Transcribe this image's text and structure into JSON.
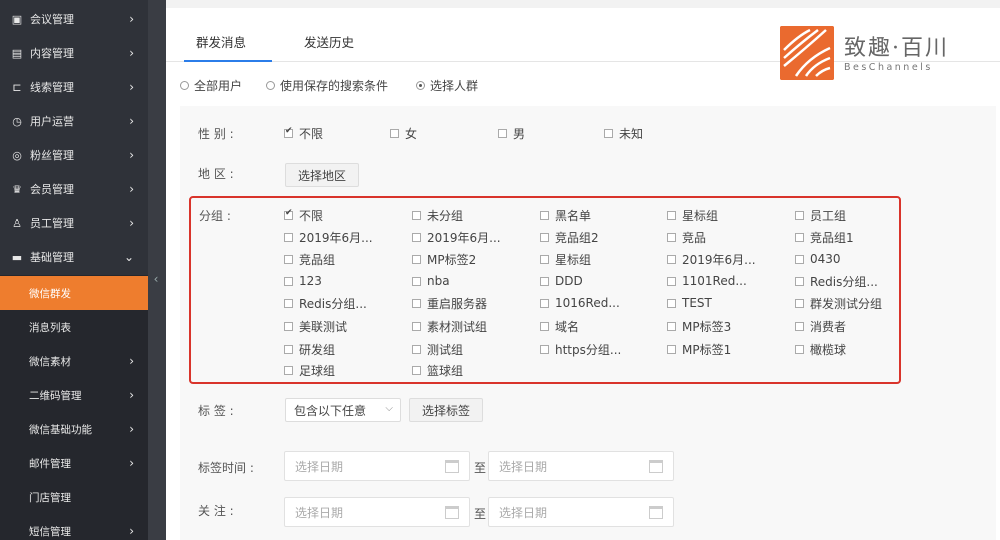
{
  "sidebar": {
    "items": [
      {
        "label": "会议管理",
        "icon": "calendar-check-icon"
      },
      {
        "label": "内容管理",
        "icon": "document-icon"
      },
      {
        "label": "线索管理",
        "icon": "link-icon"
      },
      {
        "label": "用户运营",
        "icon": "clock-icon"
      },
      {
        "label": "粉丝管理",
        "icon": "target-icon"
      },
      {
        "label": "会员管理",
        "icon": "crown-icon"
      },
      {
        "label": "员工管理",
        "icon": "person-icon"
      },
      {
        "label": "基础管理",
        "icon": "database-icon"
      }
    ],
    "subitems": [
      {
        "label": "微信群发"
      },
      {
        "label": "消息列表"
      },
      {
        "label": "微信素材"
      },
      {
        "label": "二维码管理"
      },
      {
        "label": "微信基础功能"
      },
      {
        "label": "邮件管理"
      },
      {
        "label": "门店管理"
      },
      {
        "label": "短信管理"
      }
    ],
    "collapse_glyph": "‹"
  },
  "tabs": [
    {
      "label": "群发消息",
      "active": true
    },
    {
      "label": "发送历史",
      "active": false
    }
  ],
  "logo": {
    "name": "致趣·百川",
    "sub": "BesChannels"
  },
  "audience": {
    "options": [
      "全部用户",
      "使用保存的搜索条件",
      "选择人群"
    ],
    "selected": "选择人群"
  },
  "filters": {
    "gender": {
      "label": "性  别 :",
      "options": [
        {
          "label": "不限",
          "checked": true
        },
        {
          "label": "女",
          "checked": false
        },
        {
          "label": "男",
          "checked": false
        },
        {
          "label": "未知",
          "checked": false
        }
      ]
    },
    "region": {
      "label": "地  区 :",
      "button": "选择地区"
    },
    "group": {
      "label": "分组 :",
      "options": [
        {
          "label": "不限",
          "checked": true
        },
        {
          "label": "未分组",
          "checked": false
        },
        {
          "label": "黑名单",
          "checked": false
        },
        {
          "label": "星标组",
          "checked": false
        },
        {
          "label": "员工组",
          "checked": false
        },
        {
          "label": "2019年6月...",
          "checked": false
        },
        {
          "label": "2019年6月...",
          "checked": false
        },
        {
          "label": "竞品组2",
          "checked": false
        },
        {
          "label": "竞品",
          "checked": false
        },
        {
          "label": "竞品组1",
          "checked": false
        },
        {
          "label": "竞品组",
          "checked": false
        },
        {
          "label": "MP标签2",
          "checked": false
        },
        {
          "label": "星标组",
          "checked": false
        },
        {
          "label": "2019年6月...",
          "checked": false
        },
        {
          "label": "0430",
          "checked": false
        },
        {
          "label": "123",
          "checked": false
        },
        {
          "label": "nba",
          "checked": false
        },
        {
          "label": "DDD",
          "checked": false
        },
        {
          "label": "1101Red...",
          "checked": false
        },
        {
          "label": "Redis分组...",
          "checked": false
        },
        {
          "label": "Redis分组...",
          "checked": false
        },
        {
          "label": "重启服务器",
          "checked": false
        },
        {
          "label": "1016Red...",
          "checked": false
        },
        {
          "label": "TEST",
          "checked": false
        },
        {
          "label": "群发测试分组",
          "checked": false
        },
        {
          "label": "美联测试",
          "checked": false
        },
        {
          "label": "素材测试组",
          "checked": false
        },
        {
          "label": "域名",
          "checked": false
        },
        {
          "label": "MP标签3",
          "checked": false
        },
        {
          "label": "消费者",
          "checked": false
        },
        {
          "label": "研发组",
          "checked": false
        },
        {
          "label": "测试组",
          "checked": false
        },
        {
          "label": "https分组...",
          "checked": false
        },
        {
          "label": "MP标签1",
          "checked": false
        },
        {
          "label": "橄榄球",
          "checked": false
        },
        {
          "label": "足球组",
          "checked": false
        },
        {
          "label": "篮球组",
          "checked": false
        }
      ]
    },
    "tags": {
      "label": "标  签 :",
      "select_value": "包含以下任意",
      "button": "选择标签"
    },
    "tag_time": {
      "label": "标签时间 :",
      "start_placeholder": "选择日期",
      "to": "至",
      "end_placeholder": "选择日期"
    },
    "follow": {
      "label": "关  注 :",
      "start_placeholder": "选择日期",
      "to": "至",
      "end_placeholder": "选择日期"
    }
  },
  "colors": {
    "sidebar_bg": "#2f3239",
    "active": "#ee7d2e",
    "accent": "#2b7de9",
    "highlight_border": "#d9342b",
    "logo": "#ea6a2f"
  }
}
